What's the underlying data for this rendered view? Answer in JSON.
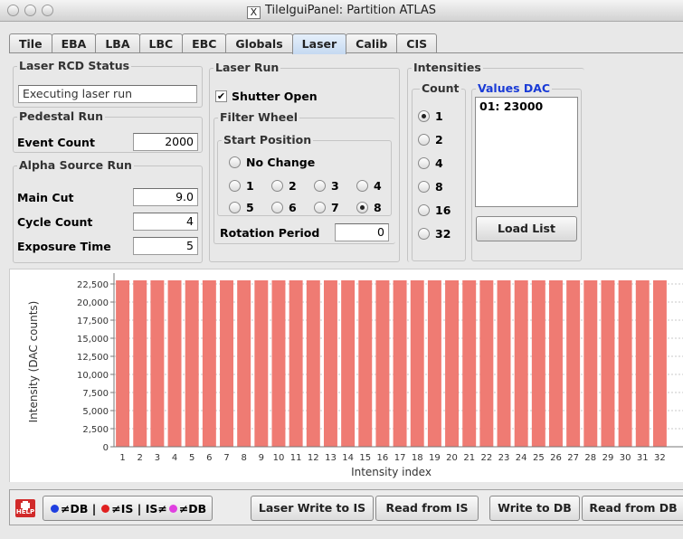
{
  "window": {
    "title": "TileIguiPanel: Partition ATLAS",
    "x_glyph": "X"
  },
  "tabs": [
    {
      "label": "Tile",
      "active": false
    },
    {
      "label": "EBA",
      "active": false
    },
    {
      "label": "LBA",
      "active": false
    },
    {
      "label": "LBC",
      "active": false
    },
    {
      "label": "EBC",
      "active": false
    },
    {
      "label": "Globals",
      "active": false
    },
    {
      "label": "Laser",
      "active": true
    },
    {
      "label": "Calib",
      "active": false
    },
    {
      "label": "CIS",
      "active": false
    }
  ],
  "laser_rcd": {
    "title": "Laser RCD Status",
    "status": "Executing laser run"
  },
  "pedestal": {
    "title": "Pedestal Run",
    "event_count_label": "Event Count",
    "event_count": "2000"
  },
  "alpha": {
    "title": "Alpha Source Run",
    "main_cut_label": "Main Cut",
    "main_cut": "9.0",
    "cycle_count_label": "Cycle Count",
    "cycle_count": "4",
    "exposure_label": "Exposure Time",
    "exposure": "5"
  },
  "laser_run": {
    "title": "Laser Run",
    "shutter_label": "Shutter Open",
    "shutter_checked": true,
    "filter_wheel_title": "Filter Wheel",
    "start_position_title": "Start Position",
    "positions": [
      {
        "label": "No Change",
        "selected": false
      },
      {
        "label": "1",
        "selected": false
      },
      {
        "label": "2",
        "selected": false
      },
      {
        "label": "3",
        "selected": false
      },
      {
        "label": "4",
        "selected": false
      },
      {
        "label": "5",
        "selected": false
      },
      {
        "label": "6",
        "selected": false
      },
      {
        "label": "7",
        "selected": false
      },
      {
        "label": "8",
        "selected": true
      }
    ],
    "rotation_label": "Rotation Period",
    "rotation": "0"
  },
  "intensities": {
    "title": "Intensities",
    "count_title": "Count",
    "counts": [
      {
        "label": "1",
        "selected": true
      },
      {
        "label": "2",
        "selected": false
      },
      {
        "label": "4",
        "selected": false
      },
      {
        "label": "8",
        "selected": false
      },
      {
        "label": "16",
        "selected": false
      },
      {
        "label": "32",
        "selected": false
      }
    ],
    "values_title": "Values DAC",
    "values": [
      "01: 23000"
    ],
    "load_list_label": "Load List"
  },
  "bottom": {
    "help_label": "HELP",
    "legend": {
      "db": "≠DB |",
      "is": "≠IS | IS≠",
      "isdb": "≠DB"
    },
    "legend_colors": {
      "db": "#1f3fe0",
      "is": "#e02020",
      "isdb": "#e040e0"
    },
    "buttons": [
      "Laser Write to IS",
      "Read from IS",
      "Write to DB",
      "Read from DB"
    ]
  },
  "chart_data": {
    "type": "bar",
    "title": "",
    "xlabel": "Intensity index",
    "ylabel": "Intensity (DAC counts)",
    "ylim": [
      0,
      23500
    ],
    "yticks": [
      0,
      2500,
      5000,
      7500,
      10000,
      12500,
      15000,
      17500,
      20000,
      22500
    ],
    "ytick_labels": [
      "0",
      "2,500",
      "5,000",
      "7,500",
      "10,000",
      "12,500",
      "15,000",
      "17,500",
      "20,000",
      "22,500"
    ],
    "categories": [
      "1",
      "2",
      "3",
      "4",
      "5",
      "6",
      "7",
      "8",
      "9",
      "10",
      "11",
      "12",
      "13",
      "14",
      "15",
      "16",
      "17",
      "18",
      "19",
      "20",
      "21",
      "22",
      "23",
      "24",
      "25",
      "26",
      "27",
      "28",
      "29",
      "30",
      "31",
      "32"
    ],
    "values": [
      23000,
      23000,
      23000,
      23000,
      23000,
      23000,
      23000,
      23000,
      23000,
      23000,
      23000,
      23000,
      23000,
      23000,
      23000,
      23000,
      23000,
      23000,
      23000,
      23000,
      23000,
      23000,
      23000,
      23000,
      23000,
      23000,
      23000,
      23000,
      23000,
      23000,
      23000,
      23000
    ],
    "bar_color": "#ef7b73",
    "grid": true
  }
}
